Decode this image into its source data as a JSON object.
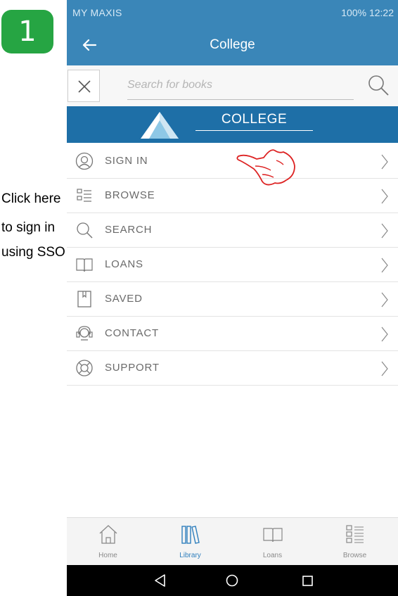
{
  "step": {
    "number": "1",
    "color": "#26a543"
  },
  "statusbar": {
    "left": "MY MAXIS",
    "right": "100%  12:22"
  },
  "appbar": {
    "title": "College",
    "back_icon": "arrow-left-icon",
    "color": "#3a86b8"
  },
  "search": {
    "placeholder": "Search for books",
    "close_icon": "close-icon",
    "search_icon": "search-icon"
  },
  "banner": {
    "text": "COLLEGE",
    "color": "#1e6fa7"
  },
  "menu": {
    "items": [
      {
        "label": "SIGN IN",
        "icon": "user-circle-icon"
      },
      {
        "label": "BROWSE",
        "icon": "list-icon"
      },
      {
        "label": "SEARCH",
        "icon": "search-icon"
      },
      {
        "label": "LOANS",
        "icon": "book-icon"
      },
      {
        "label": "SAVED",
        "icon": "bookmark-icon"
      },
      {
        "label": "CONTACT",
        "icon": "headset-icon"
      },
      {
        "label": "SUPPORT",
        "icon": "lifebuoy-icon"
      }
    ]
  },
  "annotation": {
    "line1": "Click here",
    "line2": "to sign in",
    "line3": "using SSO",
    "pointer_icon": "pointing-hand-icon"
  },
  "bottomnav": {
    "items": [
      {
        "label": "Home",
        "icon": "home-icon"
      },
      {
        "label": "Library",
        "icon": "library-icon",
        "active": true
      },
      {
        "label": "Loans",
        "icon": "book-icon"
      },
      {
        "label": "Browse",
        "icon": "list-icon"
      }
    ]
  },
  "sysnav": {
    "back": "back-triangle-icon",
    "home": "home-circle-icon",
    "recents": "recents-square-icon"
  }
}
